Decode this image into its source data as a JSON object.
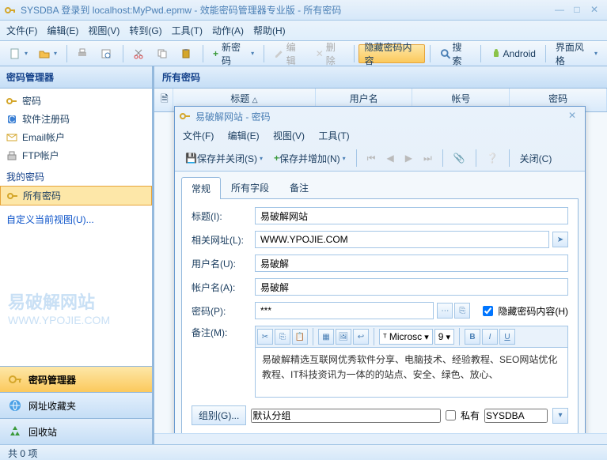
{
  "window": {
    "title": "SYSDBA 登录到 localhost:MyPwd.epmw - 效能密码管理器专业版 - 所有密码"
  },
  "menubar": [
    "文件(F)",
    "编辑(E)",
    "视图(V)",
    "转到(G)",
    "工具(T)",
    "动作(A)",
    "帮助(H)"
  ],
  "toolbar": {
    "new_pwd": "新密码",
    "edit": "编辑",
    "delete": "删除",
    "hide_content": "隐藏密码内容",
    "search": "搜索",
    "android": "Android",
    "ui_style": "界面风格"
  },
  "sidebar": {
    "header": "密码管理器",
    "items": [
      {
        "label": "密码"
      },
      {
        "label": "软件注册码"
      },
      {
        "label": "Email帐户"
      },
      {
        "label": "FTP帐户"
      }
    ],
    "my_header": "我的密码",
    "all_pwd": "所有密码",
    "custom_view": "自定义当前视图(U)...",
    "nav": [
      {
        "label": "密码管理器"
      },
      {
        "label": "网址收藏夹"
      },
      {
        "label": "回收站"
      }
    ]
  },
  "watermark": {
    "l1": "易破解网站",
    "l2": "WWW.YPOJIE.COM"
  },
  "grid": {
    "header": "所有密码",
    "cols": [
      "标题",
      "用户名",
      "帐号",
      "密码"
    ]
  },
  "dialog": {
    "title": "易破解网站 - 密码",
    "menu": [
      "文件(F)",
      "编辑(E)",
      "视图(V)",
      "工具(T)"
    ],
    "save_close": "保存并关闭(S)",
    "save_add": "保存并增加(N)",
    "close": "关闭(C)",
    "tabs": [
      "常规",
      "所有字段",
      "备注"
    ],
    "labels": {
      "title": "标题(I):",
      "url": "相关网址(L):",
      "user": "用户名(U):",
      "account": "帐户名(A):",
      "password": "密码(P):",
      "hide_pwd": "隐藏密码内容(H)",
      "memo": "备注(M):",
      "group": "组别(G)...",
      "private": "私有"
    },
    "values": {
      "title": "易破解网站",
      "url": "WWW.YPOJIE.COM",
      "user": "易破解",
      "account": "易破解",
      "password": "***",
      "group": "默认分组",
      "owner": "SYSDBA",
      "font": "Microsc",
      "fontsize": "9",
      "memo": "易破解精选互联网优秀软件分享、电脑技术、经验教程、SEO网站优化教程、IT科技资讯为一体的的站点、安全、绿色、放心、"
    }
  },
  "statusbar": "共 0 项"
}
